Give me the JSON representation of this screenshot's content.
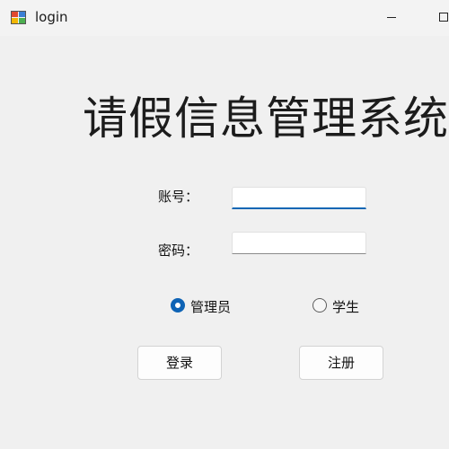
{
  "window": {
    "title": "login"
  },
  "main": {
    "heading": "请假信息管理系统",
    "account_label": "账号：",
    "account_value": "",
    "password_label": "密码：",
    "password_value": ""
  },
  "roles": {
    "admin_label": "管理员",
    "student_label": "学生",
    "selected": "管理员"
  },
  "actions": {
    "login_label": "登录",
    "register_label": "注册"
  },
  "colors": {
    "accent": "#0e63b5",
    "window_bg": "#f0f0f0"
  }
}
